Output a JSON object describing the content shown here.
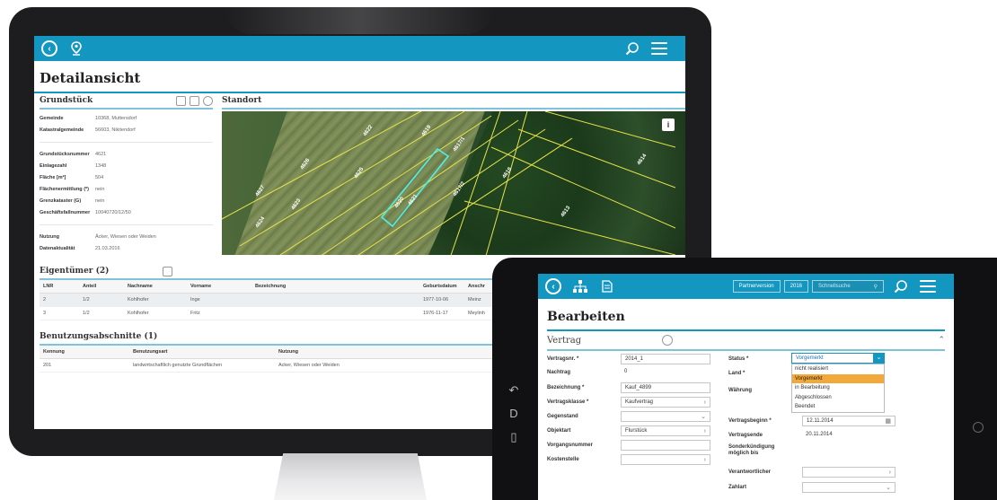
{
  "desktop": {
    "page_title": "Detailansicht",
    "grundstueck": {
      "title": "Grundstück",
      "rows_top": [
        {
          "label": "Gemeinde",
          "value": "10368, Muttersdorf"
        },
        {
          "label": "Katastralgemeinde",
          "value": "56603, Nikitendorf"
        }
      ],
      "rows_mid": [
        {
          "label": "Grundstücksnummer",
          "value": "4621"
        },
        {
          "label": "Einlagezahl",
          "value": "1348"
        },
        {
          "label": "Fläche [m²]",
          "value": "504"
        },
        {
          "label": "Flächenermittlung (*)",
          "value": "nein"
        },
        {
          "label": "Grenzkataster (G)",
          "value": "nein"
        },
        {
          "label": "Geschäftsfallnummer",
          "value": "10040720/12/50"
        }
      ],
      "rows_bottom": [
        {
          "label": "Nutzung",
          "value": "Äcker, Wiesen oder Weiden"
        },
        {
          "label": "Datenaktualität",
          "value": "21.03.2016"
        }
      ]
    },
    "standort": {
      "title": "Standort",
      "parcel_labels": [
        "4627",
        "4626",
        "4625",
        "4624",
        "4623",
        "4622",
        "4620",
        "4619",
        "4617/1",
        "4617/2",
        "4618",
        "4621",
        "4613",
        "4614"
      ]
    },
    "eigentuemer": {
      "title": "Eigentümer (2)",
      "columns": [
        "LNR",
        "Anteil",
        "Nachname",
        "Vorname",
        "Bezeichnung",
        "Geburtsdatum",
        "Anschr"
      ],
      "rows": [
        [
          "2",
          "1/2",
          "Kohlhofer",
          "Inge",
          "",
          "1977-10-06",
          "Meinz"
        ],
        [
          "3",
          "1/2",
          "Kohlhofer",
          "Fritz",
          "",
          "1976-11-17",
          "Meylinh"
        ]
      ]
    },
    "benutzung": {
      "title": "Benutzungsabschnitte (1)",
      "columns": [
        "Kennung",
        "Benutzungsart",
        "Nutzung"
      ],
      "rows": [
        [
          "201",
          "landwirtschaftlich genutzte Grundflächen",
          "Äcker, Wiesen oder Weiden"
        ]
      ]
    }
  },
  "tablet": {
    "topbar": {
      "partner_version": "Partnerversion",
      "year": "2016",
      "search_placeholder": "Schnellsuche"
    },
    "page_title": "Bearbeiten",
    "section_title": "Vertrag",
    "side_icons": [
      "back-gesture-icon",
      "d-icon",
      "square-icon"
    ],
    "form": {
      "vertragsnr": {
        "label": "Vertragsnr. *",
        "value": "2014_1"
      },
      "nachtrag": {
        "label": "Nachtrag",
        "value": "0"
      },
      "bezeichnung": {
        "label": "Bezeichnung *",
        "value": "Kauf_4899"
      },
      "vertragsklasse": {
        "label": "Vertragsklasse *",
        "value": "Kaufvertrag"
      },
      "gegenstand": {
        "label": "Gegenstand",
        "value": ""
      },
      "objektart": {
        "label": "Objektart",
        "value": "Flurstück"
      },
      "vorgangsnummer": {
        "label": "Vorgangsnummer",
        "value": ""
      },
      "kostenstelle": {
        "label": "Kostenstelle",
        "value": ""
      },
      "status": {
        "label": "Status *",
        "value": "Vorgemerkt"
      },
      "land": {
        "label": "Land *"
      },
      "waehrung": {
        "label": "Währung"
      },
      "vertragsbeginn": {
        "label": "Vertragsbeginn *",
        "value": "12.11.2014"
      },
      "vertragsende": {
        "label": "Vertragsende",
        "value": "20.11.2014"
      },
      "sonderkuendigung": {
        "label": "Sonderkündigung möglich bis"
      },
      "verantwortlicher": {
        "label": "Verantwortlicher"
      },
      "zahlart": {
        "label": "Zahlart"
      }
    },
    "status_options": [
      "nicht realisiert",
      "Vorgemerkt",
      "in Bearbeitung",
      "Abgeschlossen",
      "Beendet"
    ],
    "status_selected_index": 1
  },
  "colors": {
    "primary": "#1396bf",
    "accent_light": "#7fc3d9",
    "dropdown_highlight": "#f3a83b"
  }
}
